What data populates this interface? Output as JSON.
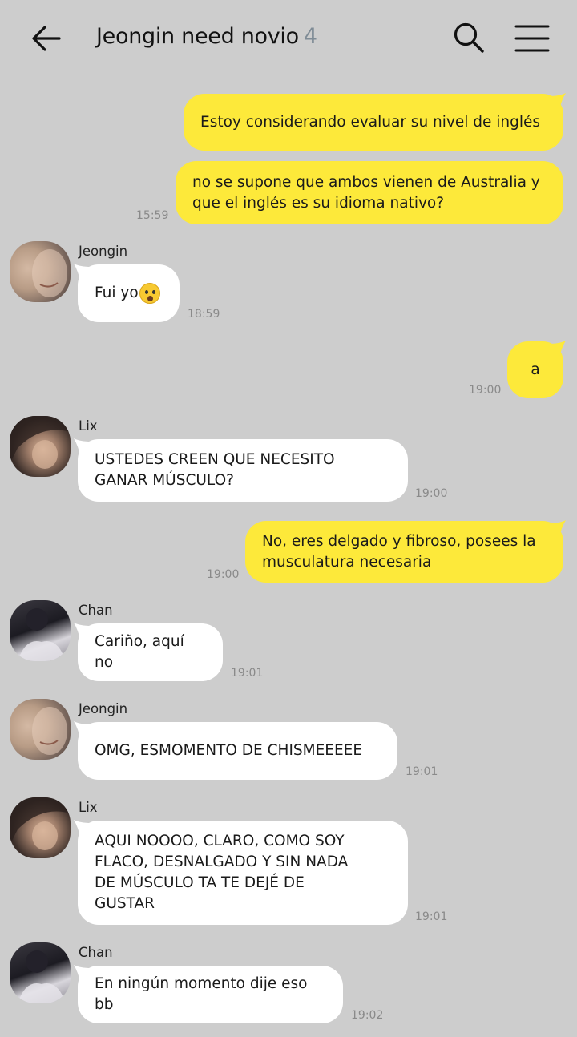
{
  "header": {
    "title": "Jeongin need novio",
    "member_count": "4"
  },
  "messages": [
    {
      "sender": "",
      "text": "Estoy considerando evaluar su nivel de inglés",
      "time": ""
    },
    {
      "sender": "",
      "text": "no se supone que ambos vienen de Australia y\nque el inglés es su idioma nativo?",
      "time": "15:59"
    },
    {
      "sender": "Jeongin",
      "text": "Fui yo",
      "time": "18:59"
    },
    {
      "sender": "",
      "text": "a",
      "time": "19:00"
    },
    {
      "sender": "Lix",
      "text": "USTEDES CREEN QUE NECESITO\nGANAR MÚSCULO?",
      "time": "19:00"
    },
    {
      "sender": "",
      "text": "No, eres delgado y fibroso, posees la\nmusculatura necesaria",
      "time": "19:00"
    },
    {
      "sender": "Chan",
      "text": "Cariño, aquí no",
      "time": "19:01"
    },
    {
      "sender": "Jeongin",
      "text": "OMG, ESMOMENTO DE CHISMEEEEE",
      "time": "19:01"
    },
    {
      "sender": "Lix",
      "text": "AQUI NOOOO, CLARO, COMO SOY\nFLACO, DESNALGADO Y SIN NADA\nDE MÚSCULO TA TE DEJÉ DE\nGUSTAR",
      "time": "19:01"
    },
    {
      "sender": "Chan",
      "text": "En ningún momento dije eso bb",
      "time": "19:02"
    }
  ],
  "icons": {
    "back": "arrow-left-icon",
    "search": "search-icon",
    "menu": "hamburger-menu-icon",
    "emoji": "anxious-face-emoji"
  },
  "colors": {
    "background": "#cdcdcd",
    "my_bubble": "#fde93a",
    "their_bubble": "#ffffff",
    "count": "#7f8c96"
  }
}
